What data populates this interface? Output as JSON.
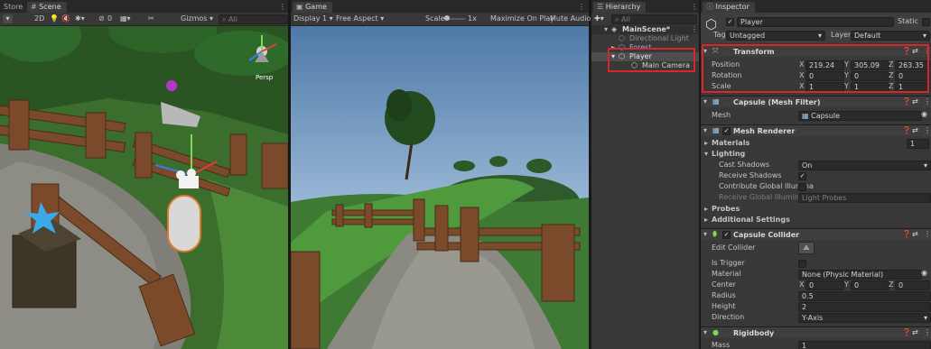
{
  "tabs": {
    "store": "Store",
    "scene": "Scene",
    "game": "Game",
    "hierarchy": "Hierarchy",
    "inspector": "Inspector"
  },
  "scene_toolbar": {
    "mode_2d": "2D",
    "hidden_count": "0",
    "gizmos": "Gizmos",
    "search_placeholder": "All",
    "persp": "Persp"
  },
  "game_toolbar": {
    "display": "Display 1",
    "aspect": "Free Aspect",
    "scale_label": "Scale",
    "scale_value": "1x",
    "maximize": "Maximize On Play",
    "mute": "Mute Audio"
  },
  "hierarchy": {
    "search_placeholder": "All",
    "items": [
      {
        "label": "MainScene*"
      },
      {
        "label": "Directional Light"
      },
      {
        "label": "Forest"
      },
      {
        "label": "Player"
      },
      {
        "label": "Main Camera"
      }
    ]
  },
  "inspector": {
    "object_name": "Player",
    "static_label": "Static",
    "tag_label": "Tag",
    "tag_value": "Untagged",
    "layer_label": "Layer",
    "layer_value": "Default",
    "transform": {
      "title": "Transform",
      "position_label": "Position",
      "rotation_label": "Rotation",
      "scale_label": "Scale",
      "x": "X",
      "y": "Y",
      "z": "Z",
      "position": [
        "219.24",
        "305.09",
        "263.35"
      ],
      "rotation": [
        "0",
        "0",
        "0"
      ],
      "scale": [
        "1",
        "1",
        "1"
      ]
    },
    "mesh_filter": {
      "title": "Capsule (Mesh Filter)",
      "mesh_label": "Mesh",
      "mesh_value": "Capsule"
    },
    "mesh_renderer": {
      "title": "Mesh Renderer",
      "materials_label": "Materials",
      "materials_count": "1",
      "lighting_label": "Lighting",
      "cast_shadows_label": "Cast Shadows",
      "cast_shadows_value": "On",
      "receive_shadows_label": "Receive Shadows",
      "contribute_gi_label": "Contribute Global Illumina",
      "receive_gi_label": "Receive Global Illuminatic",
      "receive_gi_value": "Light Probes",
      "probes_label": "Probes",
      "additional_label": "Additional Settings"
    },
    "capsule_collider": {
      "title": "Capsule Collider",
      "edit_label": "Edit Collider",
      "is_trigger_label": "Is Trigger",
      "material_label": "Material",
      "material_value": "None (Physic Material)",
      "center_label": "Center",
      "center": [
        "0",
        "0",
        "0"
      ],
      "radius_label": "Radius",
      "radius_value": "0.5",
      "height_label": "Height",
      "height_value": "2",
      "direction_label": "Direction",
      "direction_value": "Y-Axis"
    },
    "rigidbody": {
      "title": "Rigidbody",
      "mass_label": "Mass",
      "mass_value": "1"
    }
  },
  "colors": {
    "panel": "#383838",
    "header": "#3e3e3e",
    "field": "#2a2a2a",
    "highlight_red": "#d9262c",
    "selection": "#4d4d4d",
    "link_blue": "#7fb3f0"
  }
}
